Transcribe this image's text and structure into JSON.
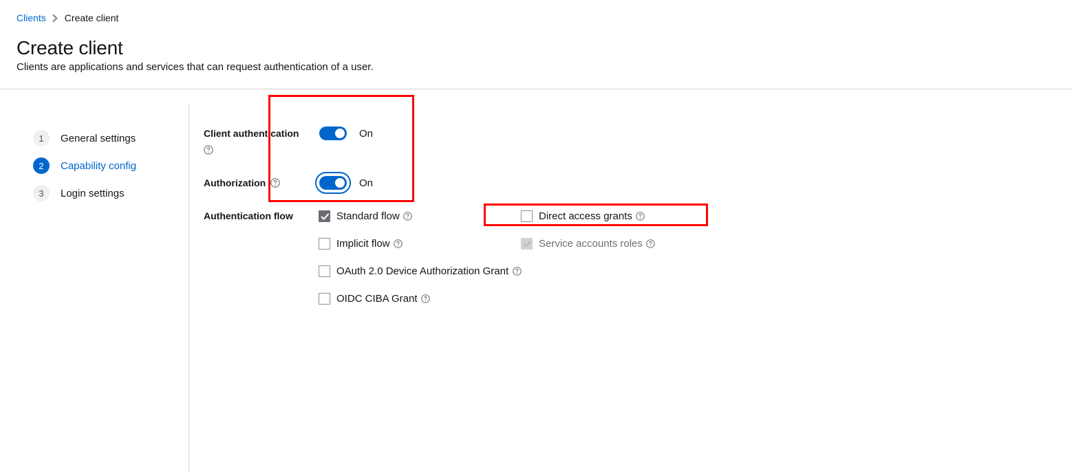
{
  "breadcrumb": {
    "parent": "Clients",
    "separator": "❯",
    "current": "Create client"
  },
  "header": {
    "title": "Create client",
    "subtitle": "Clients are applications and services that can request authentication of a user."
  },
  "wizard_nav": {
    "steps": [
      {
        "number": "1",
        "label": "General settings",
        "state": "inactive"
      },
      {
        "number": "2",
        "label": "Capability config",
        "state": "current"
      },
      {
        "number": "3",
        "label": "Login settings",
        "state": "inactive"
      }
    ]
  },
  "form": {
    "client_authentication": {
      "label": "Client authentication",
      "help_icon": "help-circle-icon",
      "toggle_state": "on",
      "toggle_text": "On"
    },
    "authorization": {
      "label": "Authorization",
      "help_icon": "help-circle-icon",
      "toggle_state": "on",
      "toggle_text": "On",
      "focused": true
    },
    "authentication_flow": {
      "label": "Authentication flow",
      "left_column": [
        {
          "label": "Standard flow",
          "checked": true,
          "disabled": false,
          "help_icon": "help-circle-icon"
        },
        {
          "label": "Implicit flow",
          "checked": false,
          "disabled": false,
          "help_icon": "help-circle-icon"
        },
        {
          "label": "OAuth 2.0 Device Authorization Grant",
          "checked": false,
          "disabled": false,
          "help_icon": "help-circle-icon"
        },
        {
          "label": "OIDC CIBA Grant",
          "checked": false,
          "disabled": false,
          "help_icon": "help-circle-icon"
        }
      ],
      "right_column": [
        {
          "label": "Direct access grants",
          "checked": false,
          "disabled": false,
          "help_icon": "help-circle-icon"
        },
        {
          "label": "Service accounts roles",
          "checked": true,
          "disabled": true,
          "help_icon": "help-circle-icon"
        }
      ]
    }
  },
  "annotations": {
    "highlight_color": "#ff0000",
    "boxes": [
      {
        "name": "toggles-highlight"
      },
      {
        "name": "direct-access-grants-highlight"
      }
    ]
  }
}
